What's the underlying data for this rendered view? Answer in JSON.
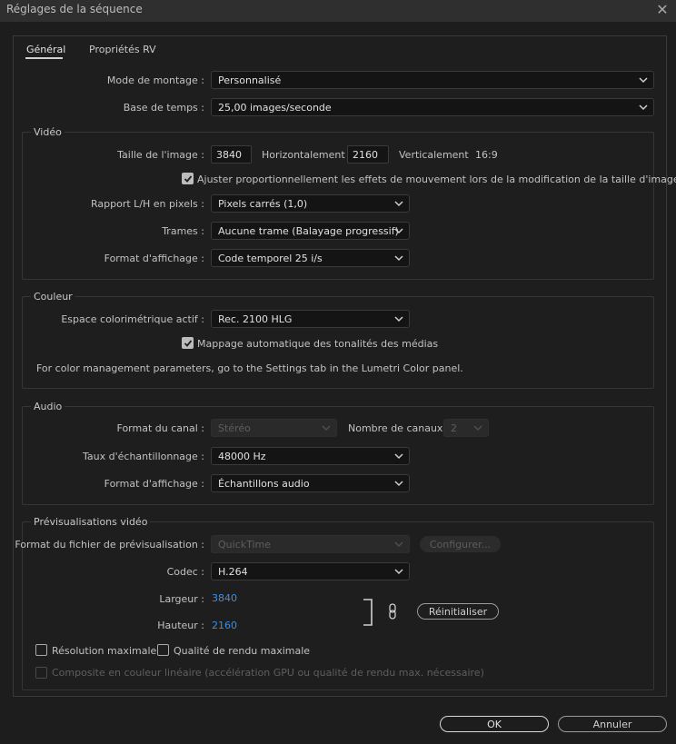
{
  "window": {
    "title": "Réglages de la séquence",
    "close_glyph": "✕"
  },
  "tabs": [
    {
      "label": "Général",
      "active": true
    },
    {
      "label": "Propriétés RV",
      "active": false
    }
  ],
  "general": {
    "editing_mode_label": "Mode de montage :",
    "editing_mode_value": "Personnalisé",
    "timebase_label": "Base de temps :",
    "timebase_value": "25,00  images/seconde"
  },
  "video": {
    "section_title": "Vidéo",
    "frame_size_label": "Taille de l'image :",
    "frame_width": "3840",
    "horizontal_label": "Horizontalement",
    "frame_height": "2160",
    "vertical_label": "Verticalement",
    "aspect_ratio": "16:9",
    "scale_motion_label": "Ajuster proportionnellement les effets de mouvement lors de la modification de la taille d'image",
    "scale_motion_checked": true,
    "pixel_aspect_label": "Rapport L/H en pixels :",
    "pixel_aspect_value": "Pixels carrés (1,0)",
    "fields_label": "Trames :",
    "fields_value": "Aucune trame (Balayage progressif)",
    "display_format_label": "Format d'affichage :",
    "display_format_value": "Code temporel 25 i/s"
  },
  "color": {
    "section_title": "Couleur",
    "working_space_label": "Espace colorimétrique actif :",
    "working_space_value": "Rec. 2100 HLG",
    "auto_tone_label": "Mappage automatique des tonalités des médias",
    "auto_tone_checked": true,
    "note": "For color management parameters, go to the Settings tab in the Lumetri Color panel."
  },
  "audio": {
    "section_title": "Audio",
    "channel_format_label": "Format du canal :",
    "channel_format_value": "Stéréo",
    "num_channels_label": "Nombre de canaux :",
    "num_channels_value": "2",
    "sample_rate_label": "Taux d'échantillonnage :",
    "sample_rate_value": "48000 Hz",
    "display_format_label": "Format d'affichage :",
    "display_format_value": "Échantillons audio"
  },
  "previews": {
    "section_title": "Prévisualisations vidéo",
    "file_format_label": "Format du fichier de prévisualisation :",
    "file_format_value": "QuickTime",
    "configure_label": "Configurer...",
    "codec_label": "Codec :",
    "codec_value": "H.264",
    "width_label": "Largeur :",
    "width_value": "3840",
    "height_label": "Hauteur :",
    "height_value": "2160",
    "reset_label": "Réinitialiser",
    "max_bit_depth_label": "Résolution maximale",
    "max_bit_depth_checked": false,
    "max_render_quality_label": "Qualité de rendu maximale",
    "max_render_quality_checked": false,
    "linear_composite_label": "Composite en couleur linéaire (accélération GPU ou qualité de rendu max. nécessaire)",
    "linear_composite_checked": false
  },
  "footer": {
    "ok_label": "OK",
    "cancel_label": "Annuler"
  }
}
